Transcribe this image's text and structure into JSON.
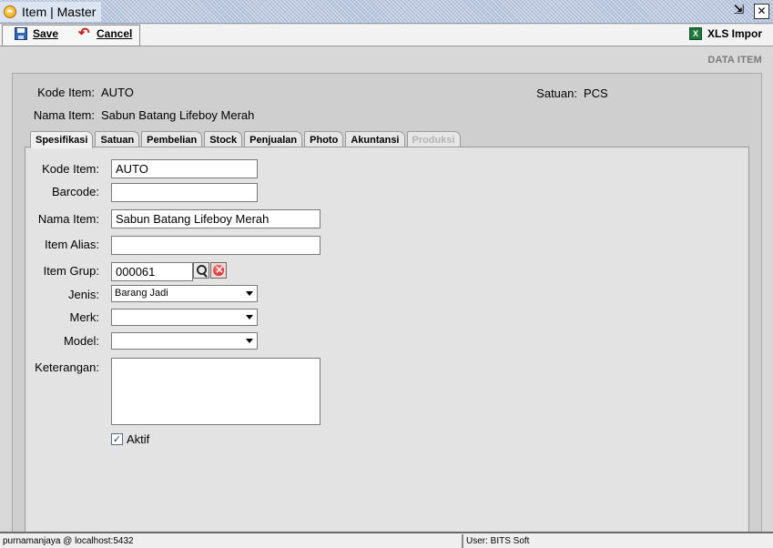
{
  "window": {
    "title": "Item | Master"
  },
  "toolbar": {
    "save_label": "Save",
    "cancel_label": "Cancel",
    "xls_label": "XLS Impor"
  },
  "header": {
    "section_label": "DATA ITEM"
  },
  "info": {
    "kode_item_label": "Kode Item:",
    "kode_item_value": "AUTO",
    "nama_item_label": "Nama Item:",
    "nama_item_value": "Sabun Batang Lifeboy Merah",
    "satuan_label": "Satuan:",
    "satuan_value": "PCS"
  },
  "tabs": [
    {
      "label": "Spesifikasi",
      "state": "active"
    },
    {
      "label": "Satuan",
      "state": "normal"
    },
    {
      "label": "Pembelian",
      "state": "normal"
    },
    {
      "label": "Stock",
      "state": "normal"
    },
    {
      "label": "Penjualan",
      "state": "normal"
    },
    {
      "label": "Photo",
      "state": "normal"
    },
    {
      "label": "Akuntansi",
      "state": "normal"
    },
    {
      "label": "Produksi",
      "state": "disabled"
    }
  ],
  "form": {
    "kode_item_label": "Kode Item:",
    "kode_item_value": "AUTO",
    "barcode_label": "Barcode:",
    "barcode_value": "",
    "nama_item_label": "Nama Item:",
    "nama_item_value": "Sabun Batang Lifeboy Merah",
    "item_alias_label": "Item Alias:",
    "item_alias_value": "",
    "item_grup_label": "Item Grup:",
    "item_grup_value": "000061",
    "jenis_label": "Jenis:",
    "jenis_value": "Barang Jadi",
    "merk_label": "Merk:",
    "merk_value": "",
    "model_label": "Model:",
    "model_value": "",
    "keterangan_label": "Keterangan:",
    "keterangan_value": "",
    "aktif_label": "Aktif",
    "aktif_checked": true
  },
  "status": {
    "left": "purnamanjaya @ localhost:5432",
    "right": "User: BITS Soft"
  }
}
